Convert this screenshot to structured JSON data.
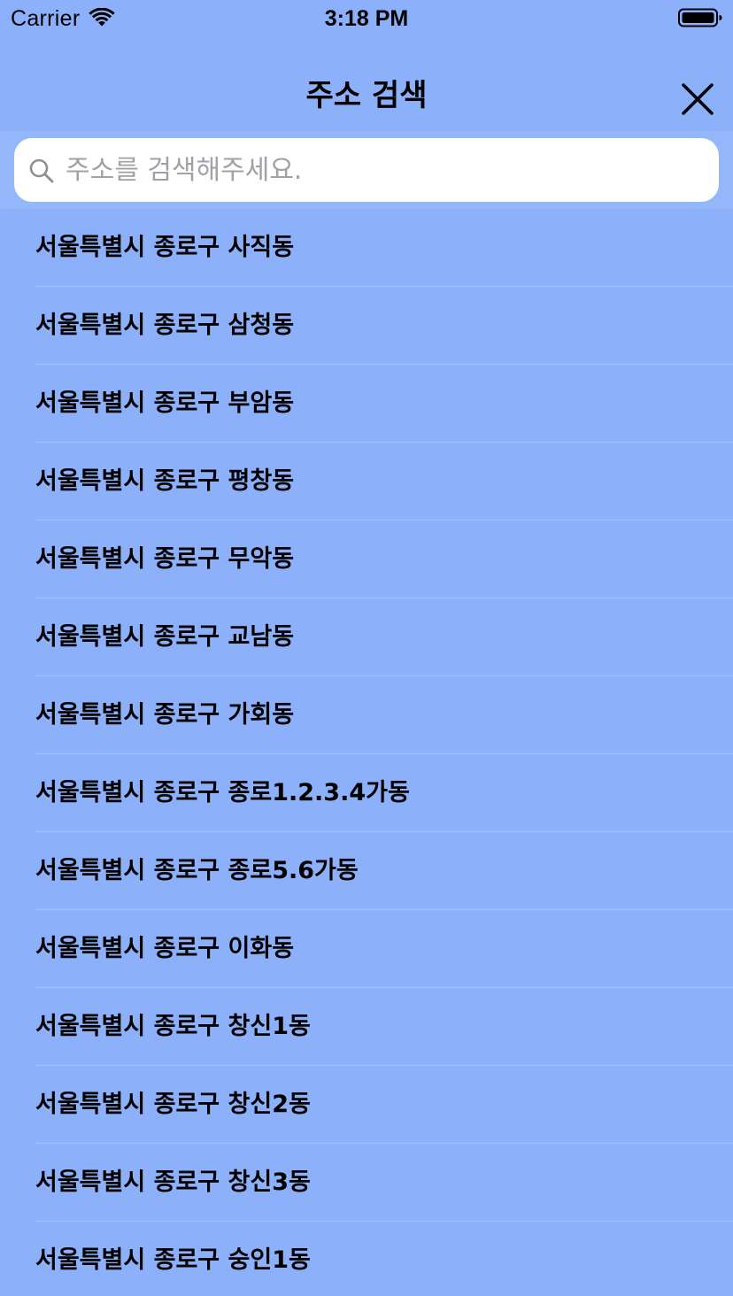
{
  "status_bar": {
    "carrier": "Carrier",
    "time": "3:18 PM",
    "wifi_icon": "wifi-icon",
    "battery_icon": "battery-icon"
  },
  "nav": {
    "title": "주소 검색",
    "close_icon": "close-icon"
  },
  "search": {
    "value": "",
    "placeholder": "주소를 검색해주세요.",
    "icon": "search-icon"
  },
  "results": [
    {
      "label": "서울특별시 종로구 사직동"
    },
    {
      "label": "서울특별시 종로구 삼청동"
    },
    {
      "label": "서울특별시 종로구 부암동"
    },
    {
      "label": "서울특별시 종로구 평창동"
    },
    {
      "label": "서울특별시 종로구 무악동"
    },
    {
      "label": "서울특별시 종로구 교남동"
    },
    {
      "label": "서울특별시 종로구 가회동"
    },
    {
      "label": "서울특별시 종로구 종로1.2.3.4가동"
    },
    {
      "label": "서울특별시 종로구 종로5.6가동"
    },
    {
      "label": "서울특별시 종로구 이화동"
    },
    {
      "label": "서울특별시 종로구 창신1동"
    },
    {
      "label": "서울특별시 종로구 창신2동"
    },
    {
      "label": "서울특별시 종로구 창신3동"
    },
    {
      "label": "서울특별시 종로구 숭인1동"
    }
  ],
  "colors": {
    "background": "#8cb0fa",
    "search_bar_background": "#94b6fb",
    "search_field": "#ffffff",
    "separator": "#a9c3fb",
    "placeholder_text": "#a0a0a6"
  }
}
